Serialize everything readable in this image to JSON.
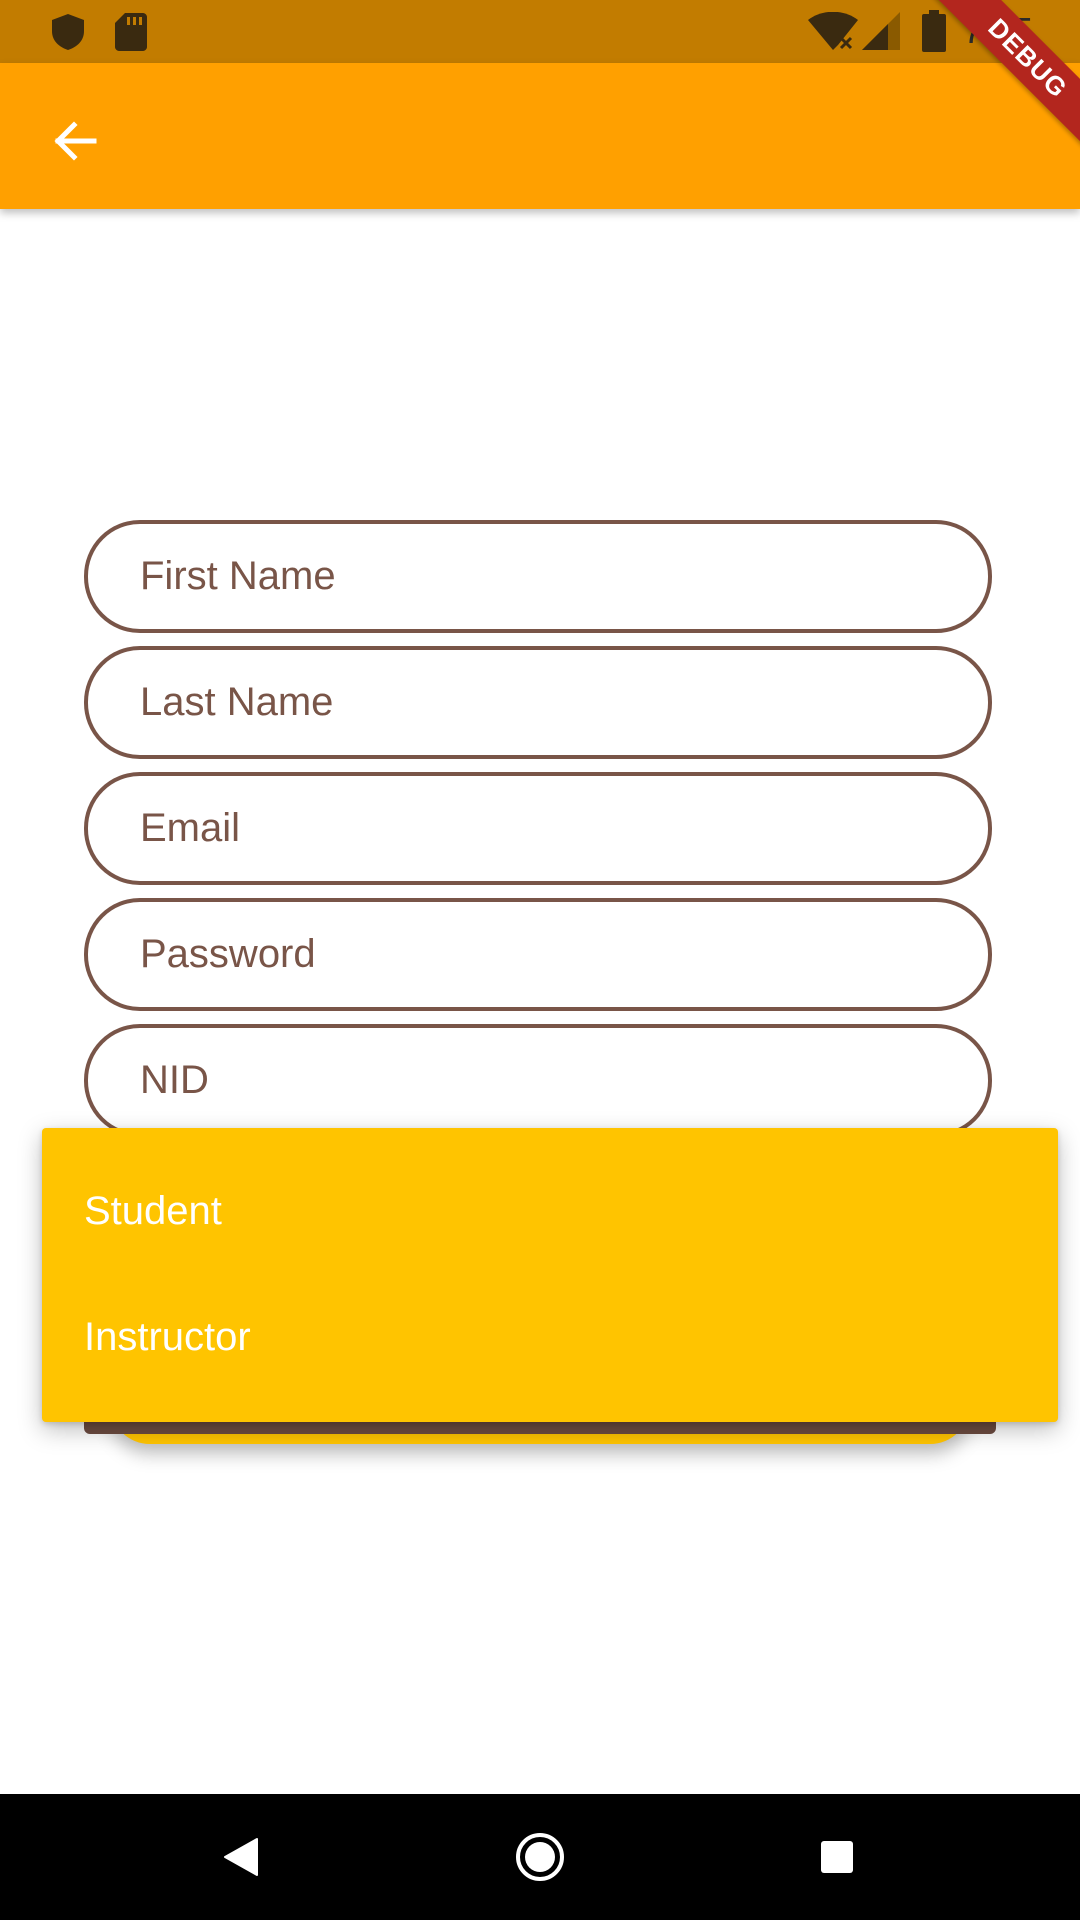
{
  "status_bar": {
    "time": "7:15",
    "background": "#c27c00",
    "icons": [
      "shield-icon",
      "sd-card-icon",
      "wifi-off-icon",
      "cellular-signal-icon",
      "battery-icon"
    ]
  },
  "app_bar": {
    "background": "#ffa000",
    "back_icon": "arrow-left-icon"
  },
  "debug_banner": {
    "label": "DEBUG",
    "color": "#b3261e"
  },
  "form": {
    "border_color": "#795548",
    "fields": [
      {
        "label": "First Name"
      },
      {
        "label": "Last Name"
      },
      {
        "label": "Email"
      },
      {
        "label": "Password"
      },
      {
        "label": "NID"
      }
    ]
  },
  "dropdown": {
    "background": "#ffc400",
    "options": [
      {
        "label": "Student"
      },
      {
        "label": "Instructor"
      }
    ]
  },
  "nav_bar": {
    "icons": [
      "back-triangle-icon",
      "home-circle-icon",
      "recents-square-icon"
    ]
  }
}
